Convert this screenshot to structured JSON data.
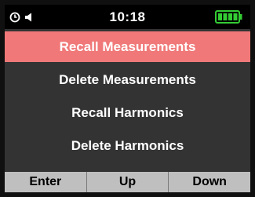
{
  "status_bar": {
    "time": "10:18",
    "clock_icon": "clock-icon",
    "speaker_icon": "speaker-icon",
    "battery_icon": "battery-full-icon",
    "battery_color": "#33cc33"
  },
  "menu": {
    "items": [
      {
        "label": "Recall Measurements",
        "selected": true
      },
      {
        "label": "Delete Measurements",
        "selected": false
      },
      {
        "label": "Recall Harmonics",
        "selected": false
      },
      {
        "label": "Delete Harmonics",
        "selected": false
      }
    ],
    "selected_color": "#f07878",
    "background_color": "#333333"
  },
  "softkeys": {
    "enter_label": "Enter",
    "up_label": "Up",
    "down_label": "Down"
  }
}
